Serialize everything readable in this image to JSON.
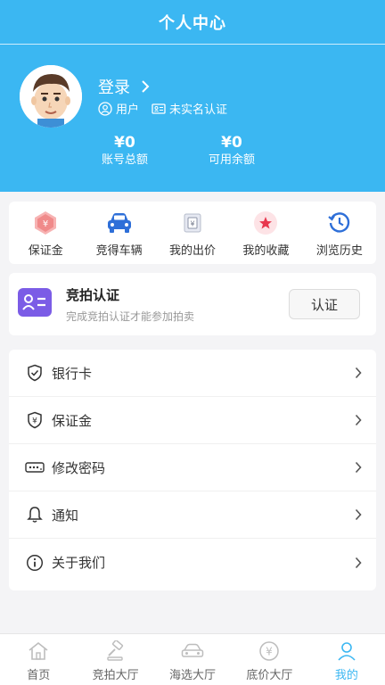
{
  "header": {
    "title": "个人中心",
    "login_label": "登录",
    "user_badge": "用户",
    "realname_badge": "未实名认证",
    "account_total": {
      "amount": "¥0",
      "label": "账号总额"
    },
    "available": {
      "amount": "¥0",
      "label": "可用余额"
    }
  },
  "quick_actions": [
    {
      "label": "保证金",
      "icon": "deposit-icon"
    },
    {
      "label": "竞得车辆",
      "icon": "car-icon"
    },
    {
      "label": "我的出价",
      "icon": "bid-icon"
    },
    {
      "label": "我的收藏",
      "icon": "star-icon"
    },
    {
      "label": "浏览历史",
      "icon": "history-icon"
    }
  ],
  "auth": {
    "title": "竞拍认证",
    "subtitle": "完成竞拍认证才能参加拍卖",
    "button": "认证"
  },
  "menu": [
    {
      "label": "银行卡",
      "icon": "shield-check-icon"
    },
    {
      "label": "保证金",
      "icon": "shield-yen-icon"
    },
    {
      "label": "修改密码",
      "icon": "password-icon"
    },
    {
      "label": "通知",
      "icon": "bell-icon"
    },
    {
      "label": "关于我们",
      "icon": "info-icon"
    }
  ],
  "tabs": [
    {
      "label": "首页",
      "icon": "home-icon"
    },
    {
      "label": "竞拍大厅",
      "icon": "gavel-icon"
    },
    {
      "label": "海选大厅",
      "icon": "car-outline-icon"
    },
    {
      "label": "底价大厅",
      "icon": "yen-circle-icon"
    },
    {
      "label": "我的",
      "icon": "person-icon",
      "active": true
    }
  ],
  "colors": {
    "accent": "#3bb7f2",
    "auth_purple": "#7b5ce6"
  }
}
